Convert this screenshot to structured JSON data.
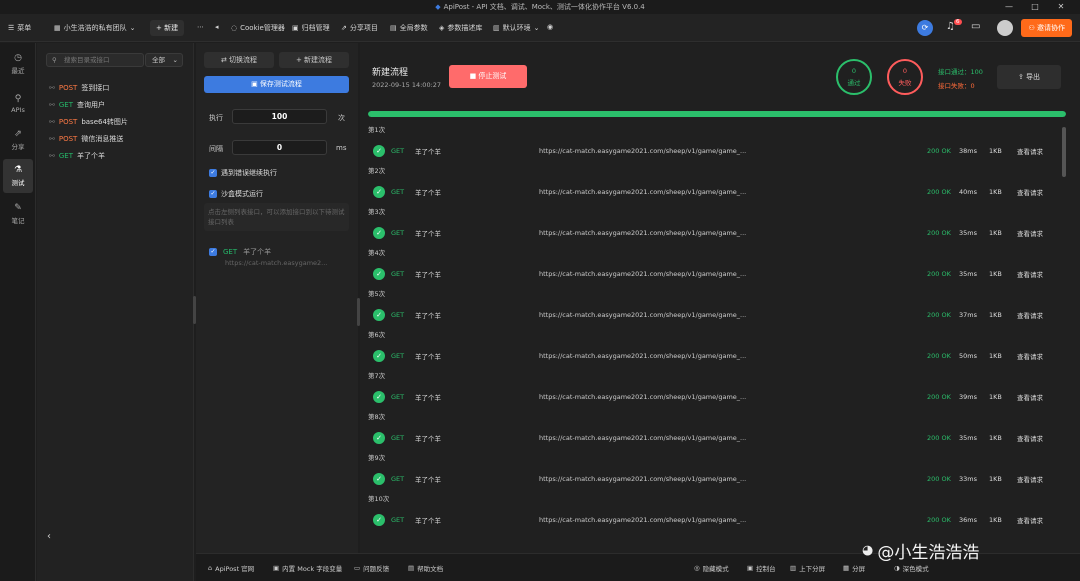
{
  "window": {
    "title": "ApiPost - API 文档、调试、Mock、测试一体化协作平台 V6.0.4",
    "controls": [
      "—",
      "□",
      "✕"
    ]
  },
  "topbar": {
    "menu_label": "菜单",
    "team_name": "小生浩浩的私有团队",
    "new_label": "+ 新建",
    "items": [
      {
        "label": "Cookie管理器",
        "icon": "cookie-icon"
      },
      {
        "label": "归档管理",
        "icon": "archive-icon"
      },
      {
        "label": "分享项目",
        "icon": "share-icon"
      },
      {
        "label": "全局参数",
        "icon": "global-params-icon"
      },
      {
        "label": "参数描述库",
        "icon": "param-library-icon"
      },
      {
        "label": "默认环境",
        "icon": "environment-icon"
      }
    ],
    "notification_count": "6",
    "invite_label": "邀请协作"
  },
  "leftnav": {
    "items": [
      {
        "label": "最近",
        "icon": "clock-icon"
      },
      {
        "label": "APIs",
        "icon": "api-icon"
      },
      {
        "label": "分享",
        "icon": "share-icon"
      },
      {
        "label": "测试",
        "icon": "test-icon",
        "active": true
      },
      {
        "label": "笔记",
        "icon": "note-icon"
      }
    ]
  },
  "sidebar": {
    "search_placeholder": "搜索目录或接口",
    "filter_value": "全部",
    "apis": [
      {
        "method": "POST",
        "name": "签到接口"
      },
      {
        "method": "GET",
        "name": "查询用户"
      },
      {
        "method": "POST",
        "name": "base64转图片"
      },
      {
        "method": "POST",
        "name": "微信消息推送"
      },
      {
        "method": "GET",
        "name": "羊了个羊"
      }
    ]
  },
  "flow_panel": {
    "switch_label": "切换流程",
    "new_label": "新建流程",
    "save_label": "保存测试流程",
    "exec_label": "执行",
    "exec_value": "100",
    "exec_unit": "次",
    "interval_label": "间隔",
    "interval_value": "0",
    "interval_unit": "ms",
    "continue_on_error": "遇到错误继续执行",
    "sandbox_mode": "沙盒模式运行",
    "hint": "点击左侧列表接口，可以添加接口到以下待测试接口列表",
    "flow_item": {
      "method": "GET",
      "name": "羊了个羊",
      "url": "https://cat-match.easygame2..."
    }
  },
  "main": {
    "title": "新建流程",
    "time": "2022-09-15 14:00:27",
    "stop_label": "停止测试",
    "pass_count": "0",
    "pass_label": "通过",
    "fail_count": "0",
    "fail_label": "失败",
    "api_pass_label": "接口通过：100",
    "api_fail_label": "接口失败：0",
    "export_label": "导出",
    "progress": 1.0,
    "results": [
      {
        "run": "第1次",
        "method": "GET",
        "name": "羊了个羊",
        "url": "https://cat-match.easygame2021.com/sheep/v1/game/game_...",
        "status": "200 OK",
        "time": "38ms",
        "size": "1KB",
        "view": "查看请求"
      },
      {
        "run": "第2次",
        "method": "GET",
        "name": "羊了个羊",
        "url": "https://cat-match.easygame2021.com/sheep/v1/game/game_...",
        "status": "200 OK",
        "time": "40ms",
        "size": "1KB",
        "view": "查看请求"
      },
      {
        "run": "第3次",
        "method": "GET",
        "name": "羊了个羊",
        "url": "https://cat-match.easygame2021.com/sheep/v1/game/game_...",
        "status": "200 OK",
        "time": "35ms",
        "size": "1KB",
        "view": "查看请求"
      },
      {
        "run": "第4次",
        "method": "GET",
        "name": "羊了个羊",
        "url": "https://cat-match.easygame2021.com/sheep/v1/game/game_...",
        "status": "200 OK",
        "time": "35ms",
        "size": "1KB",
        "view": "查看请求"
      },
      {
        "run": "第5次",
        "method": "GET",
        "name": "羊了个羊",
        "url": "https://cat-match.easygame2021.com/sheep/v1/game/game_...",
        "status": "200 OK",
        "time": "37ms",
        "size": "1KB",
        "view": "查看请求"
      },
      {
        "run": "第6次",
        "method": "GET",
        "name": "羊了个羊",
        "url": "https://cat-match.easygame2021.com/sheep/v1/game/game_...",
        "status": "200 OK",
        "time": "50ms",
        "size": "1KB",
        "view": "查看请求"
      },
      {
        "run": "第7次",
        "method": "GET",
        "name": "羊了个羊",
        "url": "https://cat-match.easygame2021.com/sheep/v1/game/game_...",
        "status": "200 OK",
        "time": "39ms",
        "size": "1KB",
        "view": "查看请求"
      },
      {
        "run": "第8次",
        "method": "GET",
        "name": "羊了个羊",
        "url": "https://cat-match.easygame2021.com/sheep/v1/game/game_...",
        "status": "200 OK",
        "time": "35ms",
        "size": "1KB",
        "view": "查看请求"
      },
      {
        "run": "第9次",
        "method": "GET",
        "name": "羊了个羊",
        "url": "https://cat-match.easygame2021.com/sheep/v1/game/game_...",
        "status": "200 OK",
        "time": "33ms",
        "size": "1KB",
        "view": "查看请求"
      },
      {
        "run": "第10次",
        "method": "GET",
        "name": "羊了个羊",
        "url": "https://cat-match.easygame2021.com/sheep/v1/game/game_...",
        "status": "200 OK",
        "time": "36ms",
        "size": "1KB",
        "view": "查看请求"
      }
    ]
  },
  "bottombar": {
    "left": [
      {
        "label": "ApiPost 官网",
        "icon": "home-icon"
      },
      {
        "label": "内置 Mock 字段变量",
        "icon": "mock-icon"
      },
      {
        "label": "问题反馈",
        "icon": "feedback-icon"
      },
      {
        "label": "帮助文档",
        "icon": "help-icon"
      }
    ],
    "right": [
      {
        "label": "隐藏模式",
        "icon": "hide-icon"
      },
      {
        "label": "控制台",
        "icon": "console-icon"
      },
      {
        "label": "上下分屏",
        "icon": "split-icon"
      },
      {
        "label": "分屏",
        "icon": "layout-icon"
      },
      {
        "label": "深色模式",
        "icon": "theme-icon"
      }
    ]
  },
  "watermark": "@小生浩浩浩",
  "colors": {
    "accent": "#3d7be0",
    "success": "#2bbf6b",
    "danger": "#ff6b6b",
    "orange": "#ff6a1a"
  }
}
